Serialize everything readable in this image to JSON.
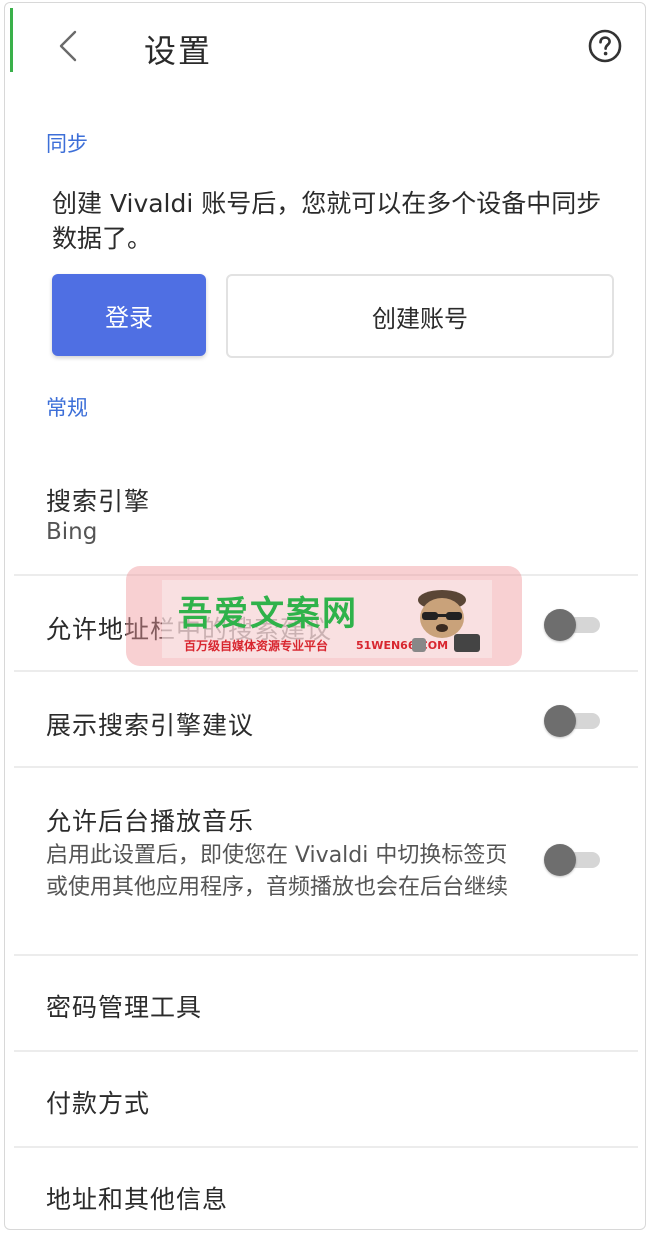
{
  "header": {
    "title": "设置"
  },
  "sync": {
    "section_label": "同步",
    "description": "创建 Vivaldi 账号后，您就可以在多个设备中同步数据了。",
    "login_label": "登录",
    "create_account_label": "创建账号"
  },
  "general": {
    "section_label": "常规",
    "items": [
      {
        "title": "搜索引擎",
        "subtitle": "Bing"
      },
      {
        "title": "允许地址栏中的搜索建议",
        "toggle": false
      },
      {
        "title": "展示搜索引擎建议",
        "toggle": false
      },
      {
        "title": "允许后台播放音乐",
        "subtitle": "启用此设置后，即使您在 Vivaldi 中切换标签页或使用其他应用程序，音频播放也会在后台继续",
        "toggle": false
      },
      {
        "title": "密码管理工具"
      },
      {
        "title": "付款方式"
      },
      {
        "title": "地址和其他信息"
      }
    ]
  },
  "watermark": {
    "title": "吾爱文案网",
    "subtitle": "百万级自媒体资源专业平台",
    "url": "51WEN66.COM"
  },
  "colors": {
    "accent_blue": "#4f6fe3",
    "section_blue": "#3d6fd8",
    "edge_green": "#3ab04a"
  }
}
